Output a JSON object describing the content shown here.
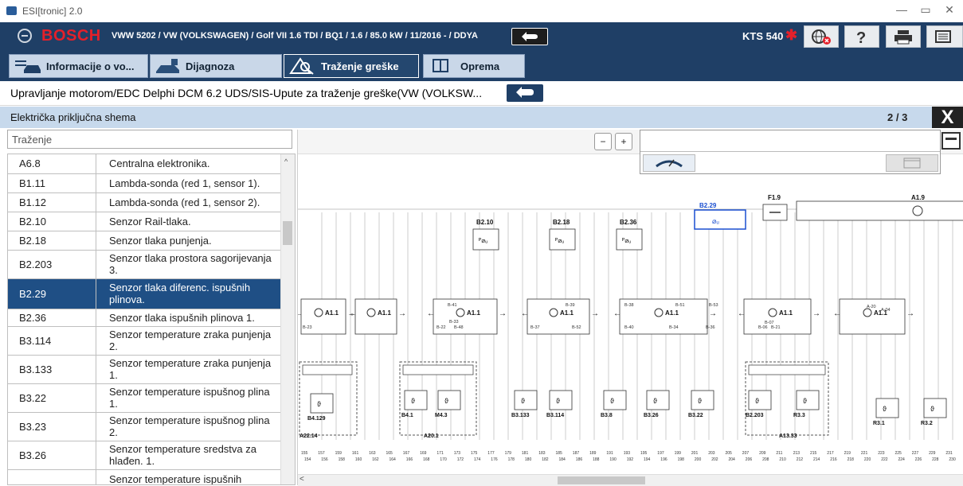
{
  "window": {
    "title": "ESI[tronic] 2.0",
    "minimize": "—",
    "restore": "▭",
    "close": "✕"
  },
  "header": {
    "brand": "BOSCH",
    "vehicle": "VWW 5202 / VW (VOLKSWAGEN) / Golf VII 1.6 TDI / BQ1 / 1.6 / 85.0 kW / 11/2016 - / DDYA",
    "device": "KTS 540",
    "bluetooth_icon": "bluetooth-icon",
    "buttons": [
      "globe-icon",
      "help-icon",
      "print-icon",
      "menu-icon"
    ]
  },
  "tabs": [
    {
      "label": "Informacije o vo...",
      "icon": "car-info-icon",
      "active": false
    },
    {
      "label": "Dijagnoza",
      "icon": "car-diagnosis-icon",
      "active": false
    },
    {
      "label": "Traženje greške",
      "icon": "trouble-search-icon",
      "active": true
    },
    {
      "label": "Oprema",
      "icon": "book-icon",
      "active": false
    }
  ],
  "path": {
    "text": "Upravljanje motorom/EDC Delphi DCM 6.2 UDS/SIS-Upute za traženje greške(VW (VOLKSW..."
  },
  "section": {
    "title": "Električka priključna shema",
    "page": "2 / 3",
    "close": "X"
  },
  "search": {
    "placeholder": "Traženje"
  },
  "components": [
    {
      "code": "A6.8",
      "desc": "Centralna elektronika."
    },
    {
      "code": "B1.11",
      "desc": "Lambda-sonda (red 1, sensor 1)."
    },
    {
      "code": "B1.12",
      "desc": "Lambda-sonda (red 1, sensor 2)."
    },
    {
      "code": "B2.10",
      "desc": "Senzor Rail-tlaka."
    },
    {
      "code": "B2.18",
      "desc": "Senzor tlaka punjenja."
    },
    {
      "code": "B2.203",
      "desc": "Senzor tlaka prostora sagorijevanja 3."
    },
    {
      "code": "B2.29",
      "desc": "Senzor tlaka diferenc. ispušnih plinova.",
      "selected": true
    },
    {
      "code": "B2.36",
      "desc": "Senzor tlaka ispušnih plinova 1."
    },
    {
      "code": "B3.114",
      "desc": "Senzor temperature zraka punjenja 2."
    },
    {
      "code": "B3.133",
      "desc": "Senzor temperature zraka punjenja 1."
    },
    {
      "code": "B3.22",
      "desc": "Senzor temperature ispušnog plina 1."
    },
    {
      "code": "B3.23",
      "desc": "Senzor temperature ispušnog plina 2."
    },
    {
      "code": "B3.26",
      "desc": "Senzor temperature sredstva za hlađen. 1."
    },
    {
      "code": "",
      "desc": "Senzor temperature ispušnih"
    }
  ],
  "diagram": {
    "top_sensors": [
      "B2.10",
      "B2.18",
      "B2.36",
      "B2.29",
      "F1.9",
      "A1.9"
    ],
    "modules": [
      "A1.1",
      "A1.1",
      "A1.1",
      "A1.1",
      "A1.1",
      "A1.1",
      "A1.1"
    ],
    "module_pins": [
      "B-23",
      "B-41",
      "B-33",
      "B-22",
      "B-48",
      "B-39",
      "B-37",
      "B-52",
      "B-38",
      "B-51",
      "B-53",
      "B-40",
      "B-34",
      "B-36",
      "B-07",
      "B-06",
      "B-21",
      "A-20",
      "A-04"
    ],
    "bottom_sensors": [
      "B4.129",
      "B4.1",
      "M4.3",
      "B3.133",
      "B3.114",
      "B3.8",
      "B3.26",
      "B3.22",
      "B2.203",
      "R3.3",
      "R3.1",
      "R3.2"
    ],
    "groups": [
      "A22.14",
      "A20.1",
      "A13.33"
    ],
    "pin_row_1": [
      "155",
      "157",
      "159",
      "161",
      "163",
      "165",
      "167",
      "169",
      "171",
      "173",
      "175",
      "177",
      "179",
      "181",
      "183",
      "185",
      "187",
      "189",
      "191",
      "193",
      "195",
      "197",
      "199",
      "201",
      "203",
      "205",
      "207",
      "209",
      "211",
      "213",
      "215",
      "217",
      "219",
      "221",
      "223",
      "225",
      "227",
      "229",
      "231"
    ],
    "pin_row_2": [
      "154",
      "156",
      "158",
      "160",
      "162",
      "164",
      "166",
      "168",
      "170",
      "172",
      "174",
      "176",
      "178",
      "180",
      "182",
      "184",
      "186",
      "188",
      "190",
      "192",
      "194",
      "196",
      "198",
      "200",
      "202",
      "204",
      "206",
      "208",
      "210",
      "212",
      "214",
      "216",
      "218",
      "220",
      "222",
      "224",
      "226",
      "228",
      "230"
    ]
  }
}
